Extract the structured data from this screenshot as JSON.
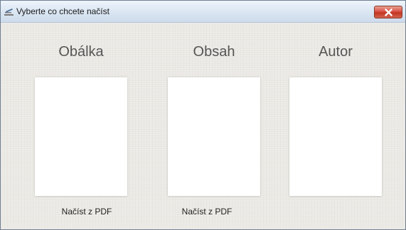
{
  "window": {
    "title": "Vyberte co chcete načíst",
    "icon": "document-edit-icon",
    "close_icon": "close-icon"
  },
  "columns": [
    {
      "heading": "Obálka",
      "action": "Načíst z PDF"
    },
    {
      "heading": "Obsah",
      "action": "Načíst z PDF"
    },
    {
      "heading": "Autor"
    }
  ],
  "colors": {
    "heading": "#555555",
    "background": "#ebe9e4",
    "close_button": "#d9534a"
  }
}
